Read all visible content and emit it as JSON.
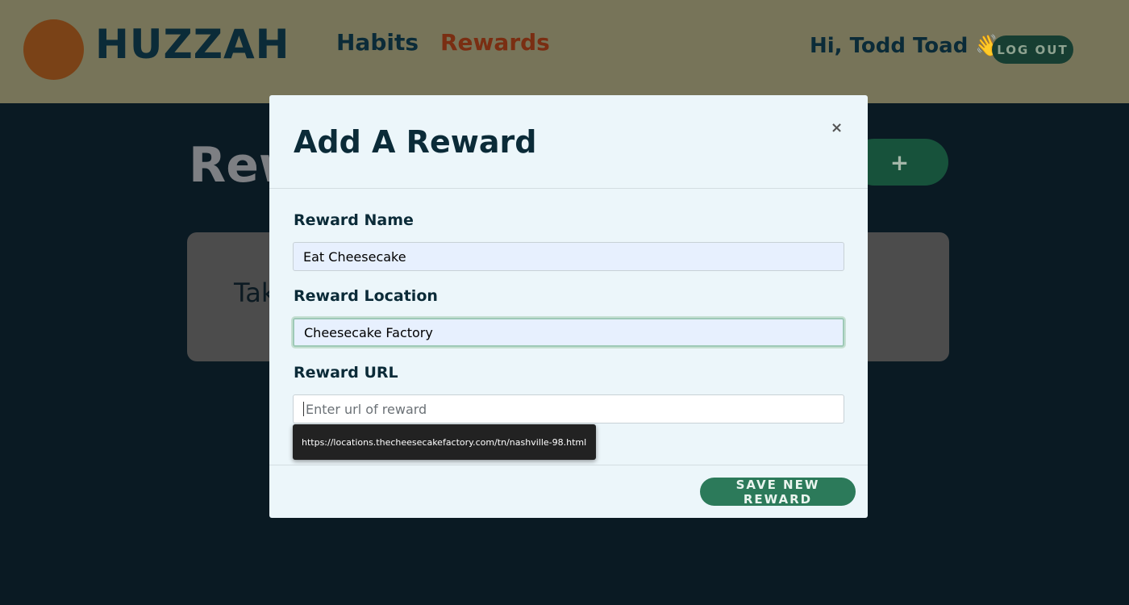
{
  "navbar": {
    "brand": "HUZZAH",
    "links": [
      {
        "label": "Habits"
      },
      {
        "label": "Rewards"
      }
    ],
    "greeting": "Hi, Todd Toad 👋",
    "logout_label": "LOG OUT"
  },
  "page": {
    "title": "Rewards",
    "add_label": "+",
    "card_title": "Take"
  },
  "modal": {
    "title": "Add A Reward",
    "close_label": "×",
    "fields": [
      {
        "label": "Reward Name",
        "value": "Eat Cheesecake",
        "placeholder": ""
      },
      {
        "label": "Reward Location",
        "value": "Cheesecake Factory",
        "placeholder": ""
      },
      {
        "label": "Reward URL",
        "value": "",
        "placeholder": "Enter url of reward"
      }
    ],
    "tooltip": "https://locations.thecheesecakefactory.com/tn/nashville-98.html",
    "save_label": "SAVE NEW REWARD"
  },
  "colors": {
    "navbar_bg": "#777459",
    "page_bg": "#0a1a23",
    "modal_bg": "#ecf6fa",
    "accent_green": "#2c7a5a",
    "brand_dark": "#0b2b38",
    "rewards_link": "#7a2e12"
  }
}
